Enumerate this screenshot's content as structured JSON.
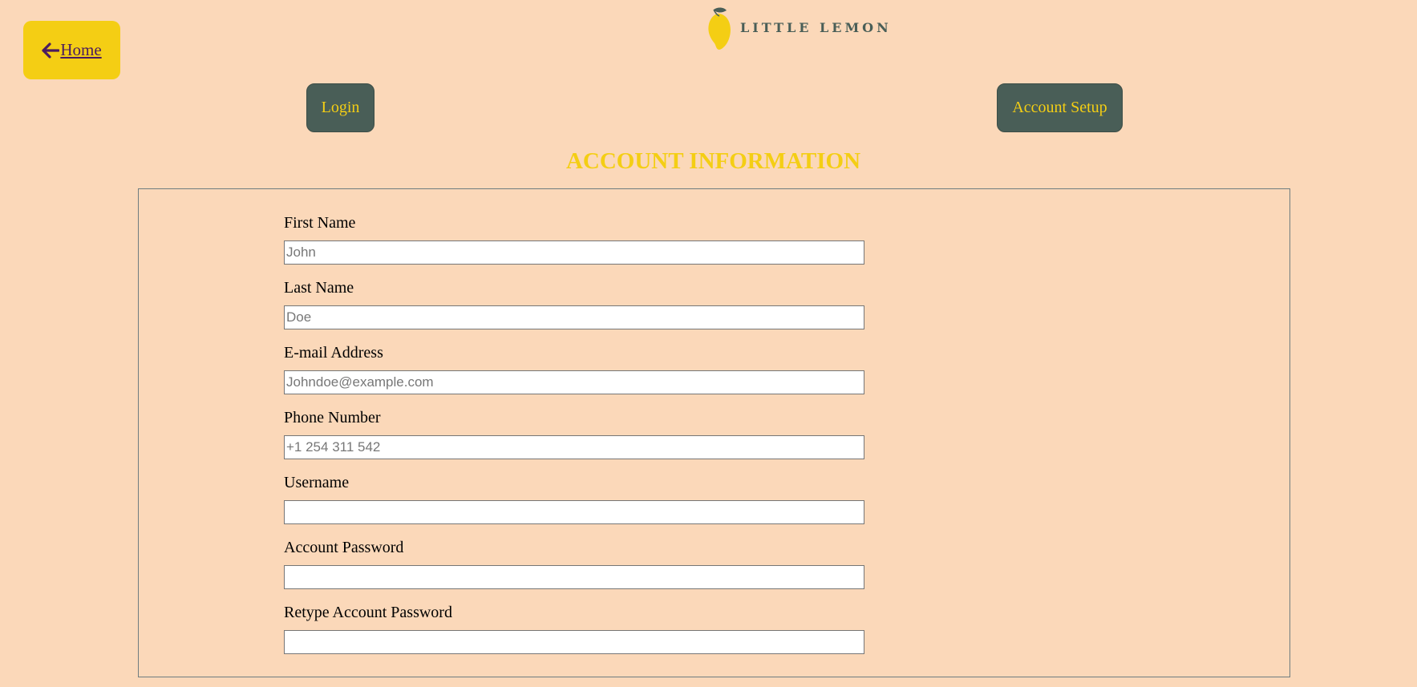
{
  "nav": {
    "home_label": "Home",
    "home_icon": "arrow-left-icon",
    "link_color": "#4b1c5e",
    "home_bg": "#f4ce14"
  },
  "brand": {
    "name": "LITTLE LEMON",
    "logo_icon": "lemon-icon",
    "color": "#495e57"
  },
  "buttons": {
    "login_label": "Login",
    "account_setup_label": "Account Setup",
    "bg_color": "#495e57",
    "text_color": "#f4ce14"
  },
  "page": {
    "title": "ACCOUNT INFORMATION",
    "background": "#fbd8b9",
    "title_color": "#f4ce14"
  },
  "form": {
    "fields": [
      {
        "label": "First Name",
        "value": "",
        "placeholder": "John"
      },
      {
        "label": "Last Name",
        "value": "",
        "placeholder": "Doe"
      },
      {
        "label": "E-mail Address",
        "value": "",
        "placeholder": "Johndoe@example.com"
      },
      {
        "label": "Phone Number",
        "value": "",
        "placeholder": "+1 254 311 542"
      },
      {
        "label": "Username",
        "value": "",
        "placeholder": ""
      },
      {
        "label": "Account Password",
        "value": "",
        "placeholder": ""
      },
      {
        "label": "Retype Account Password",
        "value": "",
        "placeholder": ""
      }
    ]
  }
}
